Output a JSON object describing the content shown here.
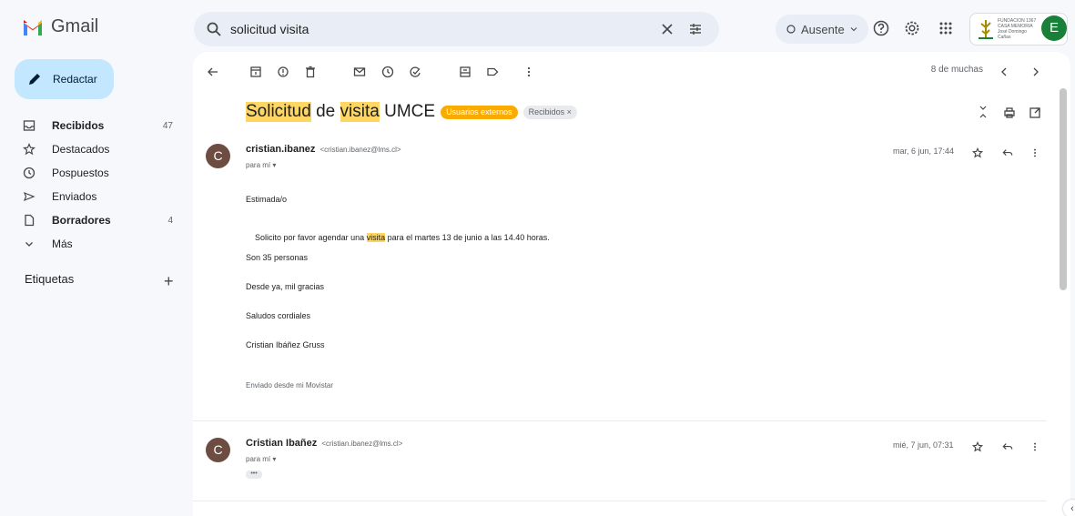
{
  "app": {
    "name": "Gmail"
  },
  "colors": {
    "accent": "#c2e7ff",
    "highlight": "#fdd663",
    "label_ext": "#f9ab00",
    "avatar_user": "#188038",
    "avatar_sender": "#6d4c41"
  },
  "search": {
    "query": "solicitud visita"
  },
  "header": {
    "status_label": "Ausente",
    "org_badge_text": "FUNDACION 1367 CASA MEMORIA José Domingo Cañas",
    "avatar_letter": "E",
    "icons": [
      "help-icon",
      "settings-icon",
      "apps-icon"
    ]
  },
  "sidebar": {
    "compose_label": "Redactar",
    "items": [
      {
        "label": "Recibidos",
        "count": "47",
        "bold": true,
        "icon": "inbox-icon"
      },
      {
        "label": "Destacados",
        "count": "",
        "bold": false,
        "icon": "star-icon"
      },
      {
        "label": "Pospuestos",
        "count": "",
        "bold": false,
        "icon": "clock-icon"
      },
      {
        "label": "Enviados",
        "count": "",
        "bold": false,
        "icon": "send-icon"
      },
      {
        "label": "Borradores",
        "count": "4",
        "bold": true,
        "icon": "draft-icon"
      },
      {
        "label": "Más",
        "count": "",
        "bold": false,
        "icon": "chevron-down-icon"
      }
    ],
    "labels_heading": "Etiquetas"
  },
  "toolbar": {
    "counter": "8 de muchas",
    "icons": [
      "back-icon",
      "archive-icon",
      "report-spam-icon",
      "delete-icon",
      "mark-unread-icon",
      "snooze-icon",
      "add-task-icon",
      "move-to-icon",
      "label-icon",
      "more-icon"
    ]
  },
  "thread": {
    "subject_parts": [
      "Solicitud",
      " de ",
      "visita",
      " UMCE"
    ],
    "labels": [
      "Usuarios externos",
      "Recibidos ×"
    ],
    "messages": [
      {
        "avatar_letter": "C",
        "sender": "cristian.ibanez",
        "email": "<cristian.ibanez@lms.cl>",
        "to": "para mí",
        "date": "mar, 6 jun, 17:44",
        "body": {
          "greeting": "Estimada/o",
          "line1_before": "Solicito por favor agendar una ",
          "line1_hl": "visita",
          "line1_after": " para el martes 13 de junio a las 14.40 horas.",
          "line2": "Son 35 personas",
          "line3": "Desde ya, mil gracias",
          "line4": "Saludos cordiales",
          "line5": "Cristian Ibáñez Gruss",
          "signature": "Enviado desde mi Movistar"
        }
      },
      {
        "avatar_letter": "C",
        "sender": "Cristian Ibañez",
        "email": "<cristian.ibanez@lms.cl>",
        "to": "para mí",
        "date": "mié, 7 jun, 07:31",
        "collapsed": "•••"
      }
    ]
  }
}
